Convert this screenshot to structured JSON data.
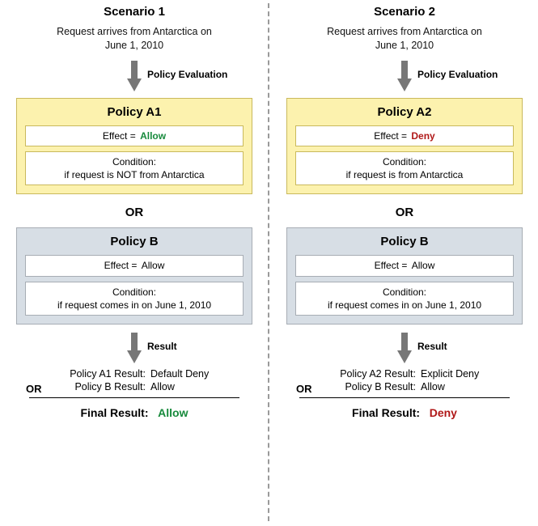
{
  "common": {
    "eval_label": "Policy Evaluation",
    "result_label": "Result",
    "or": "OR",
    "effect_prefix": "Effect = ",
    "condition_prefix": "Condition:",
    "final_label": "Final Result:",
    "allow_word": "Allow",
    "deny_word": "Deny"
  },
  "scenarios": [
    {
      "title": "Scenario 1",
      "subtitle": "Request arrives from Antarctica on\nJune 1, 2010",
      "policyA": {
        "name": "Policy A1",
        "effect": "Allow",
        "effect_class": "allow",
        "condition": "if request is NOT from Antarctica"
      },
      "policyB": {
        "name": "Policy B",
        "effect": "Allow",
        "effect_class": "",
        "condition": "if request comes in on June 1, 2010"
      },
      "results": {
        "a_label": "Policy A1 Result:",
        "a_value": "Default Deny",
        "b_label": "Policy B Result:",
        "b_value": "Allow",
        "final_value": "Allow",
        "final_class": "allow"
      }
    },
    {
      "title": "Scenario 2",
      "subtitle": "Request arrives from Antarctica on\nJune 1, 2010",
      "policyA": {
        "name": "Policy A2",
        "effect": "Deny",
        "effect_class": "deny",
        "condition": "if request is from Antarctica"
      },
      "policyB": {
        "name": "Policy B",
        "effect": "Allow",
        "effect_class": "",
        "condition": "if request comes in on June 1, 2010"
      },
      "results": {
        "a_label": "Policy A2 Result:",
        "a_value": "Explicit Deny",
        "b_label": "Policy B Result:",
        "b_value": "Allow",
        "final_value": "Deny",
        "final_class": "deny"
      }
    }
  ],
  "chart_data": {
    "type": "table",
    "title": "Policy evaluation comparison: implicit vs explicit deny",
    "columns": [
      "scenario",
      "policy",
      "effect",
      "condition",
      "result",
      "final"
    ],
    "rows": [
      [
        "Scenario 1",
        "Policy A1",
        "Allow",
        "if request is NOT from Antarctica",
        "Default Deny",
        "Allow"
      ],
      [
        "Scenario 1",
        "Policy B",
        "Allow",
        "if request comes in on June 1, 2010",
        "Allow",
        "Allow"
      ],
      [
        "Scenario 2",
        "Policy A2",
        "Deny",
        "if request is from Antarctica",
        "Explicit Deny",
        "Deny"
      ],
      [
        "Scenario 2",
        "Policy B",
        "Allow",
        "if request comes in on June 1, 2010",
        "Allow",
        "Deny"
      ]
    ]
  }
}
